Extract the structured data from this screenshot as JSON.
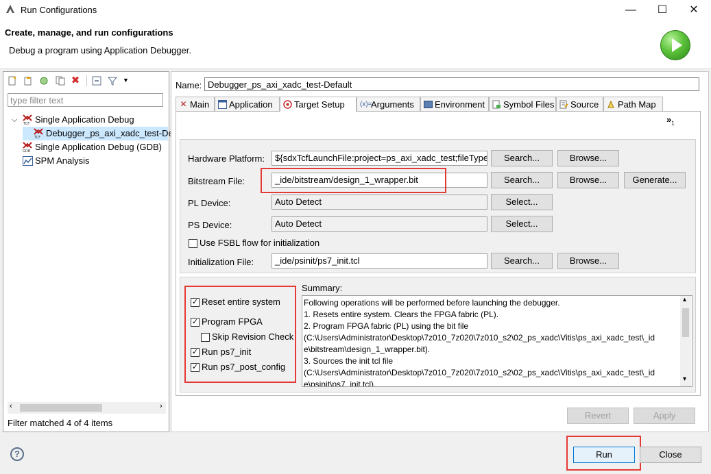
{
  "window": {
    "title": "Run Configurations",
    "minimize": "—",
    "maximize": "☐",
    "close": "✕"
  },
  "header": {
    "title": "Create, manage, and run configurations",
    "subtitle": "Debug a program using Application Debugger."
  },
  "left": {
    "filter_placeholder": "type filter text",
    "tree": [
      {
        "label": "Single Application Debug",
        "icon": "tcf-icon"
      },
      {
        "label": "Debugger_ps_axi_xadc_test-De",
        "icon": "tcf-icon"
      },
      {
        "label": "Single Application Debug (GDB)",
        "icon": "gdb-icon"
      },
      {
        "label": "SPM Analysis",
        "icon": "spm-icon"
      }
    ],
    "filter_status": "Filter matched 4 of 4 items"
  },
  "config": {
    "name_label": "Name:",
    "name_value": "Debugger_ps_axi_xadc_test-Default",
    "tabs": [
      "Main",
      "Application",
      "Target Setup",
      "Arguments",
      "Environment",
      "Symbol Files",
      "Source",
      "Path Map"
    ],
    "overflow": "»",
    "overflow_count": "1"
  },
  "target": {
    "hw_label": "Hardware Platform:",
    "hw_value": "${sdxTcfLaunchFile:project=ps_axi_xadc_test;fileType=",
    "bit_label": "Bitstream File:",
    "bit_value": "_ide/bitstream/design_1_wrapper.bit",
    "pl_label": "PL Device:",
    "pl_value": "Auto Detect",
    "ps_label": "PS Device:",
    "ps_value": "Auto Detect",
    "fsbl_label": "Use FSBL flow for initialization",
    "init_label": "Initialization File:",
    "init_value": "_ide/psinit/ps7_init.tcl",
    "search": "Search...",
    "browse": "Browse...",
    "generate": "Generate...",
    "select": "Select..."
  },
  "options": {
    "reset": "Reset entire system",
    "program": "Program FPGA",
    "skip": "Skip Revision Check",
    "ps7init": "Run ps7_init",
    "postconfig": "Run ps7_post_config"
  },
  "summary": {
    "label": "Summary:",
    "lines": [
      "Following operations will be performed before launching the debugger.",
      "1. Resets entire system. Clears the FPGA fabric (PL).",
      "2. Program FPGA fabric (PL) using the bit file",
      "(C:\\Users\\Administrator\\Desktop\\7z010_7z020\\7z010_s2\\02_ps_xadc\\Vitis\\ps_axi_xadc_test\\_id",
      "e\\bitstream\\design_1_wrapper.bit).",
      "3. Sources the init tcl file",
      "(C:\\Users\\Administrator\\Desktop\\7z010_7z020\\7z010_s2\\02_ps_xadc\\Vitis\\ps_axi_xadc_test\\_id",
      "e\\psinit\\ps7_init.tcl)."
    ]
  },
  "buttons": {
    "revert": "Revert",
    "apply": "Apply",
    "run": "Run",
    "close": "Close",
    "help": "?"
  },
  "colors": {
    "highlight": "#e53935",
    "run_icon": "#3aa52a"
  }
}
